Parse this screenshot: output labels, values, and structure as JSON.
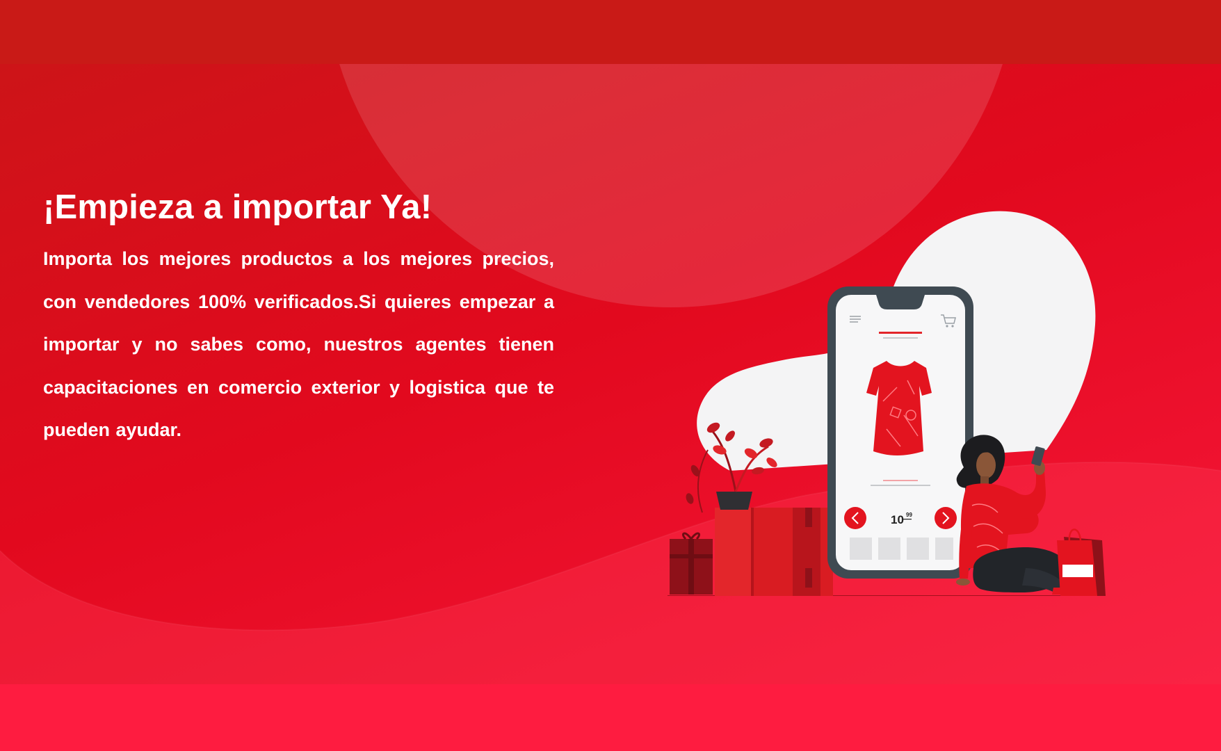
{
  "hero": {
    "headline": "¡Empieza a importar Ya!",
    "description": "Importa los mejores productos a los mejores precios, con vendedores 100% verificados.Si quieres empezar a importar y no sabes como, nuestros agentes tienen capacitaciones en comercio exterior y logistica que te pueden ayudar."
  },
  "illustration": {
    "price_main": "10",
    "price_cents": "99"
  },
  "colors": {
    "top_band": "#c91a17",
    "hero_start": "#cd1418",
    "hero_end": "#f7173a",
    "bottom_band": "#fe1c40",
    "text": "#ffffff"
  }
}
